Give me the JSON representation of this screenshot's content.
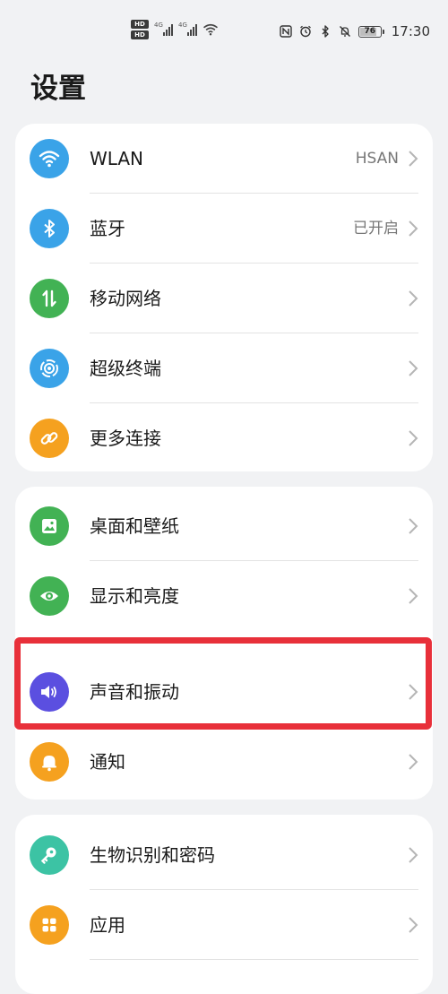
{
  "status_bar": {
    "left_icons": [
      "hd-badge-icon",
      "hd-badge-icon",
      "signal-4g-icon",
      "signal-4g-icon",
      "wifi-icon"
    ],
    "hd_label": "HD",
    "network_label": "4G",
    "right_icons": [
      "nfc-icon",
      "alarm-icon",
      "bluetooth-icon",
      "mute-icon",
      "battery-icon"
    ],
    "battery": {
      "level": "76",
      "fraction": 0.76
    },
    "time": "17:30"
  },
  "page_title": "设置",
  "groups": [
    {
      "items": [
        {
          "label": "WLAN",
          "value": "HSAN",
          "icon": "wifi-icon",
          "icon_color": "#3aa3e8"
        },
        {
          "label": "蓝牙",
          "value": "已开启",
          "icon": "bluetooth-icon",
          "icon_color": "#3aa3e8"
        },
        {
          "label": "移动网络",
          "value": "",
          "icon": "mobile-data-icon",
          "icon_color": "#42b254"
        },
        {
          "label": "超级终端",
          "value": "",
          "icon": "super-device-icon",
          "icon_color": "#3aa3e8"
        },
        {
          "label": "更多连接",
          "value": "",
          "icon": "link-icon",
          "icon_color": "#f5a11f"
        }
      ]
    },
    {
      "items": [
        {
          "label": "桌面和壁纸",
          "value": "",
          "icon": "wallpaper-icon",
          "icon_color": "#42b254"
        },
        {
          "label": "显示和亮度",
          "value": "",
          "icon": "eye-icon",
          "icon_color": "#42b254"
        },
        {
          "label": "声音和振动",
          "value": "",
          "icon": "speaker-icon",
          "icon_color": "#5b4fe0"
        },
        {
          "label": "通知",
          "value": "",
          "icon": "bell-icon",
          "icon_color": "#f5a11f"
        }
      ]
    },
    {
      "items": [
        {
          "label": "生物识别和密码",
          "value": "",
          "icon": "key-icon",
          "icon_color": "#3cc3a4"
        },
        {
          "label": "应用",
          "value": "",
          "icon": "apps-icon",
          "icon_color": "#f5a11f"
        }
      ]
    }
  ],
  "highlight_color": "#e8303a"
}
